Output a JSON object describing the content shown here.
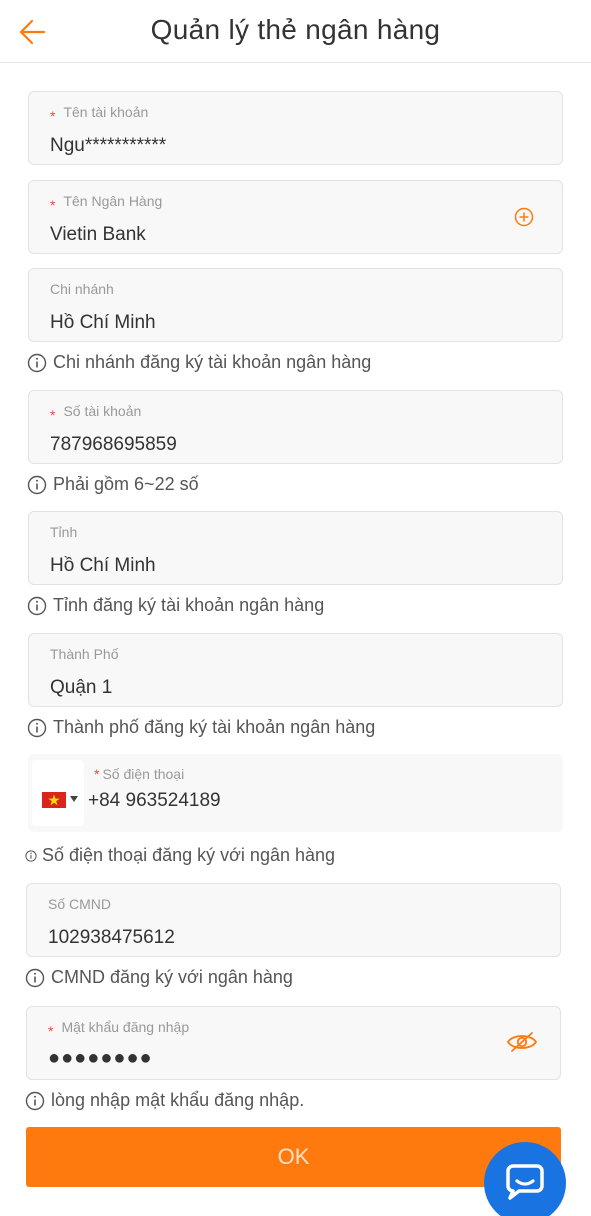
{
  "header": {
    "title": "Quản lý thẻ ngân hàng",
    "back_icon": "arrow-left-icon"
  },
  "colors": {
    "accent": "#fe7a0e",
    "required": "#e74c3c",
    "chat": "#1973e0"
  },
  "form": {
    "account_name": {
      "label": "Tên tài khoản",
      "value": "Ngu***********",
      "required": "*"
    },
    "bank_name": {
      "label": "Tên Ngân Hàng",
      "value": "Vietin Bank",
      "required": "*",
      "icon": "add-circle-icon"
    },
    "branch": {
      "label": "Chi nhánh",
      "value": "Hồ Chí Minh",
      "hint": "Chi nhánh đăng ký tài khoản ngân hàng"
    },
    "account_number": {
      "label": "Số tài khoản",
      "value": "787968695859",
      "required": "*",
      "hint": "Phải gồm 6~22 số"
    },
    "province": {
      "label": "Tỉnh",
      "value": "Hồ Chí Minh",
      "hint": "Tỉnh đăng ký tài khoản ngân hàng"
    },
    "city": {
      "label": "Thành Phố",
      "value": "Quận 1",
      "hint": "Thành phố đăng ký tài khoản ngân hàng"
    },
    "phone": {
      "label": "Số điện thoại",
      "value": "+84 963524189",
      "required": "*",
      "country_flag": "vietnam-flag-icon",
      "hint": "Số điện thoại đăng ký với ngân hàng"
    },
    "id_card": {
      "label": "Số CMND",
      "value": "102938475612",
      "hint": "CMND đăng ký với ngân hàng"
    },
    "password": {
      "label": "Mật khẩu đăng nhập",
      "value": "●●●●●●●●",
      "required": "*",
      "icon": "eye-off-icon",
      "hint": "lòng nhập mật khẩu đăng nhập."
    }
  },
  "submit": {
    "label": "OK"
  },
  "chat": {
    "icon": "chat-bubble-icon"
  }
}
